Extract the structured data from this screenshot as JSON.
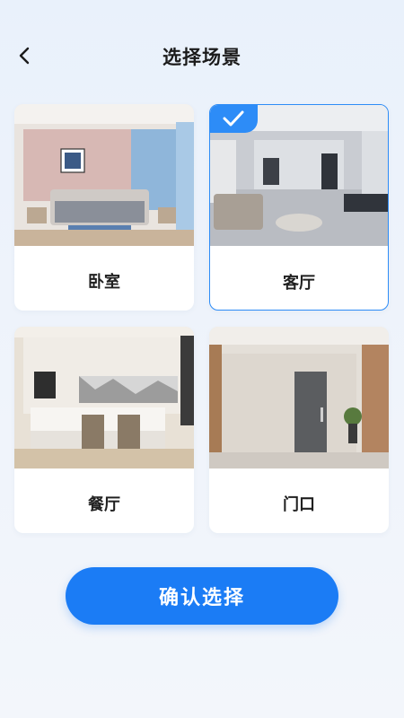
{
  "header": {
    "title": "选择场景",
    "back_icon": "chevron-left-icon"
  },
  "scenes": [
    {
      "id": "bedroom",
      "label": "卧室",
      "selected": false
    },
    {
      "id": "living-room",
      "label": "客厅",
      "selected": true
    },
    {
      "id": "dining-room",
      "label": "餐厅",
      "selected": false
    },
    {
      "id": "entrance",
      "label": "门口",
      "selected": false
    }
  ],
  "confirm": {
    "label": "确认选择"
  },
  "colors": {
    "accent": "#1b7cf5",
    "selected_border": "#2d8cf7",
    "card_bg": "#ffffff"
  }
}
